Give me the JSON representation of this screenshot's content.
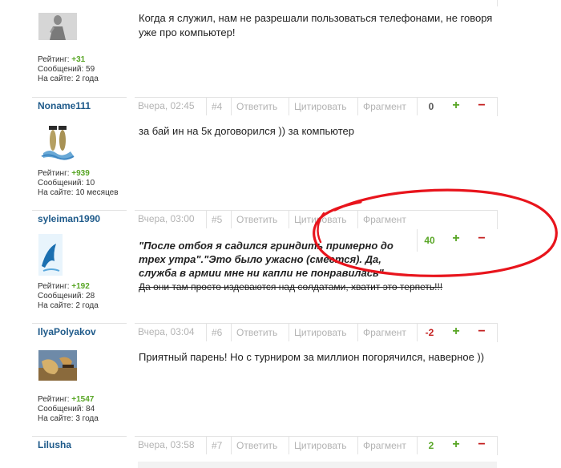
{
  "labels": {
    "rating": "Рейтинг:",
    "messages": "Сообщений:",
    "online": "На сайте:",
    "reply": "Ответить",
    "quote": "Цитировать",
    "fragment": "Фрагмент",
    "plus": "+",
    "minus": "−"
  },
  "posts": [
    {
      "username": "",
      "date": "",
      "num": "",
      "score": "",
      "rating": "+31",
      "messages": "59",
      "online": "2 года",
      "text": "Когда я служил, нам не разрешали пользоваться телефонами, не говоря уже про компьютер!"
    },
    {
      "username": "Noname111",
      "date": "Вчера, 02:45",
      "num": "#4",
      "score": "0",
      "rating": "+939",
      "messages": "10",
      "online": "10 месяцев",
      "text": "за бай ин на 5к договорился )) за компьютер"
    },
    {
      "username": "syleiman1990",
      "date": "Вчера, 03:00",
      "num": "#5",
      "score": "40",
      "rating": "+192",
      "messages": "28",
      "online": "2 года",
      "text_bold": "\"После отбоя я садился гриндить примерно до трех утра\".\"Это было ужасно (смеется). Да, служба в армии мне ни капли не понравилась\"",
      "text_strike": "Да они там просто издеваются над солдатами, хватит это терпеть!!!"
    },
    {
      "username": "IlyaPolyakov",
      "date": "Вчера, 03:04",
      "num": "#6",
      "score": "-2",
      "rating": "+1547",
      "messages": "84",
      "online": "3 года",
      "text": "Приятный парень! Но с турниром за миллион погорячился, наверное ))"
    },
    {
      "username": "Lilusha",
      "date": "Вчера, 03:58",
      "num": "#7",
      "score": "2"
    }
  ],
  "colors": {
    "username": "#1e5a8a",
    "plus": "#59a626",
    "minus": "#c41f1f",
    "annotation": "#e8141c",
    "muted": "#b3b3b3"
  }
}
